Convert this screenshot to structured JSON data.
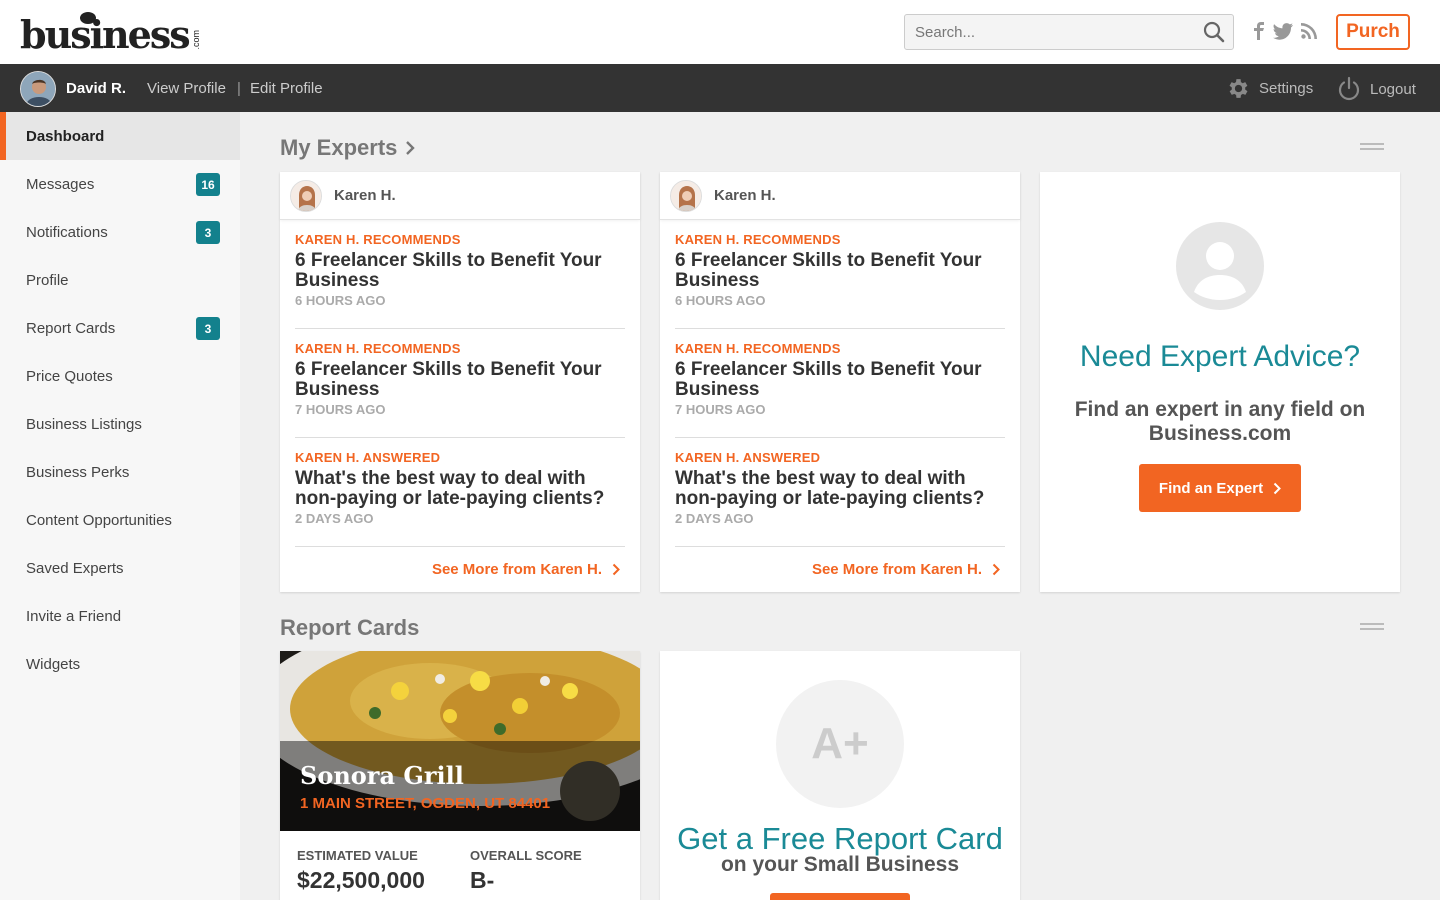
{
  "header": {
    "logo_text": "business",
    "logo_suffix": ".com",
    "search_placeholder": "Search...",
    "purch_label": "Purch"
  },
  "userbar": {
    "name": "David R.",
    "view_profile": "View Profile",
    "separator": "|",
    "edit_profile": "Edit Profile",
    "settings": "Settings",
    "logout": "Logout"
  },
  "sidebar": {
    "items": [
      {
        "label": "Dashboard",
        "badge": ""
      },
      {
        "label": "Messages",
        "badge": "16"
      },
      {
        "label": "Notifications",
        "badge": "3"
      },
      {
        "label": "Profile",
        "badge": ""
      },
      {
        "label": "Report Cards",
        "badge": "3"
      },
      {
        "label": "Price Quotes",
        "badge": ""
      },
      {
        "label": "Business Listings",
        "badge": ""
      },
      {
        "label": "Business Perks",
        "badge": ""
      },
      {
        "label": "Content Opportunities",
        "badge": ""
      },
      {
        "label": "Saved Experts",
        "badge": ""
      },
      {
        "label": "Invite a Friend",
        "badge": ""
      },
      {
        "label": "Widgets",
        "badge": ""
      }
    ]
  },
  "experts": {
    "section_title": "My Experts",
    "cards": [
      {
        "name": "Karen H.",
        "entries": [
          {
            "kicker": "Karen H. Recommends",
            "title": "6 Freelancer Skills to Benefit Your Business",
            "time": "6 Hours Ago"
          },
          {
            "kicker": "Karen H. Recommends",
            "title": "6 Freelancer Skills to Benefit Your Business",
            "time": "7 Hours Ago"
          },
          {
            "kicker": "Karen H. Answered",
            "title": "What's the best way to deal with non-paying or late-paying clients?",
            "time": "2 Days Ago"
          }
        ],
        "see_more": "See More from Karen H."
      },
      {
        "name": "Karen H.",
        "entries": [
          {
            "kicker": "Karen H. Recommends",
            "title": "6 Freelancer Skills to Benefit Your Business",
            "time": "6 Hours Ago"
          },
          {
            "kicker": "Karen H. Recommends",
            "title": "6 Freelancer Skills to Benefit Your Business",
            "time": "7 Hours Ago"
          },
          {
            "kicker": "Karen H. Answered",
            "title": "What's the best way to deal with non-paying or late-paying clients?",
            "time": "2 Days Ago"
          }
        ],
        "see_more": "See More from Karen H."
      }
    ],
    "advice": {
      "title": "Need Expert Advice?",
      "subtitle": "Find an expert in any field on Business.com",
      "button": "Find an Expert"
    }
  },
  "report_cards": {
    "section_title": "Report Cards",
    "business": {
      "name": "Sonora Grill",
      "address": "1 MAIN STREET, OGDEN, UT 84401",
      "estimated_value_label": "ESTIMATED VALUE",
      "estimated_value": "$22,500,000",
      "overall_score_label": "OVERALL SCORE",
      "overall_score": "B-"
    },
    "free": {
      "grade": "A+",
      "title": "Get a Free Report Card",
      "subtitle": "on your Small Business"
    }
  },
  "colors": {
    "accent_orange": "#f26522",
    "teal": "#13818d",
    "dark_bar": "#333333"
  }
}
